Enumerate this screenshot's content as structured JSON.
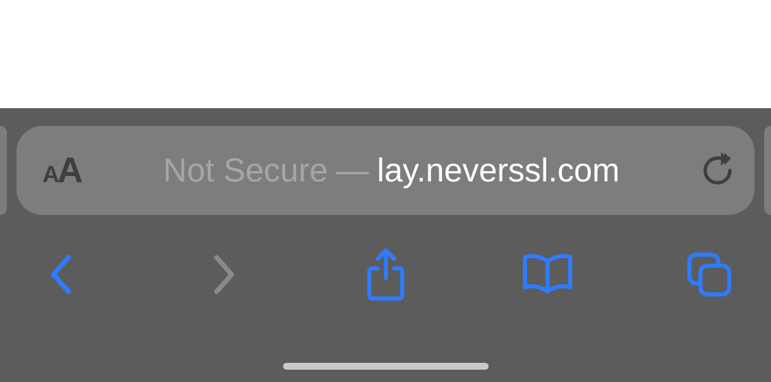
{
  "address_bar": {
    "security_status": "Not Secure",
    "separator": "—",
    "url_display": "lay.neverssl.com"
  },
  "colors": {
    "chrome_bg": "#5c5c5c",
    "bar_bg": "#7d7d7d",
    "accent": "#2f7bff",
    "muted": "#a6a6a6",
    "dark_icon": "#3e3e3e",
    "url_text": "#ffffff",
    "forward_disabled": "#8a8a8a"
  }
}
